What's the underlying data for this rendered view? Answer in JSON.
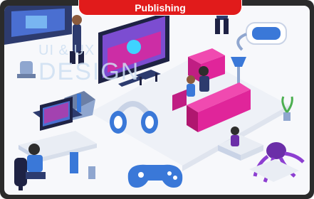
{
  "tag": {
    "label": "Publishing"
  },
  "watermark": {
    "line1": "UI & UX",
    "line2": "DESIGN"
  },
  "colors": {
    "accent": "#e11b1b",
    "frame": "#2b2b2b",
    "magenta": "#e0259a",
    "blue": "#3a78d8",
    "purple": "#6b2ea8"
  },
  "illustration": {
    "icons": [
      "gamer-desk-icon",
      "vr-headset-icon",
      "headphones-icon",
      "gamepad-icon",
      "sofa-icon",
      "tv-screen-icon",
      "robot-icon",
      "octopus-icon",
      "plant-icon"
    ]
  }
}
